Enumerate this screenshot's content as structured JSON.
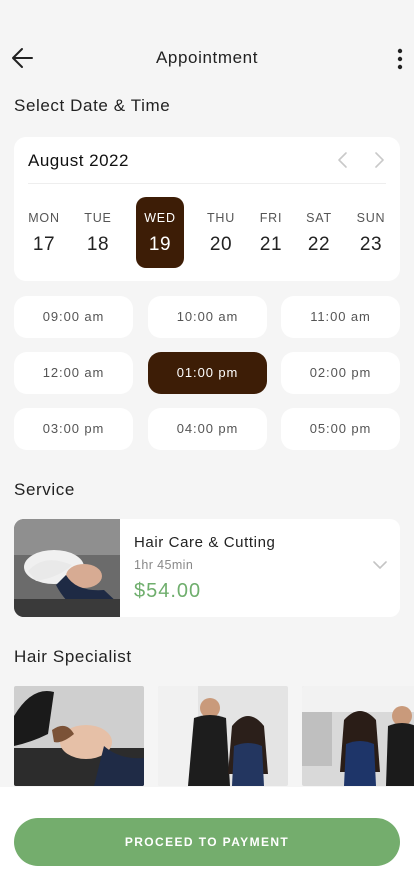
{
  "header": {
    "title": "Appointment"
  },
  "date_section": {
    "title": "Select Date & Time",
    "month": "August 2022",
    "days": [
      {
        "name": "MON",
        "num": "17"
      },
      {
        "name": "TUE",
        "num": "18"
      },
      {
        "name": "WED",
        "num": "19"
      },
      {
        "name": "THU",
        "num": "20"
      },
      {
        "name": "FRI",
        "num": "21"
      },
      {
        "name": "SAT",
        "num": "22"
      },
      {
        "name": "SUN",
        "num": "23"
      }
    ],
    "selected_day": "WED 19"
  },
  "time_slots": [
    "09:00 am",
    "10:00 am",
    "11:00 am",
    "12:00 am",
    "01:00 pm",
    "02:00 pm",
    "03:00 pm",
    "04:00 pm",
    "05:00 pm"
  ],
  "selected_time": "01:00 pm",
  "service_section": {
    "title": "Service",
    "name": "Hair Care & Cutting",
    "duration": "1hr 45min",
    "price": "$54.00"
  },
  "specialist_section": {
    "title": "Hair Specialist"
  },
  "footer": {
    "proceed_label": "PROCEED TO PAYMENT"
  },
  "colors": {
    "accent_dark": "#3d1d06",
    "price_green": "#6fae6d",
    "button_green": "#74ad6d",
    "background": "#f5f5f5"
  },
  "icons": [
    "back-arrow-icon",
    "more-vertical-icon",
    "chevron-left-icon",
    "chevron-right-icon",
    "chevron-down-icon"
  ]
}
